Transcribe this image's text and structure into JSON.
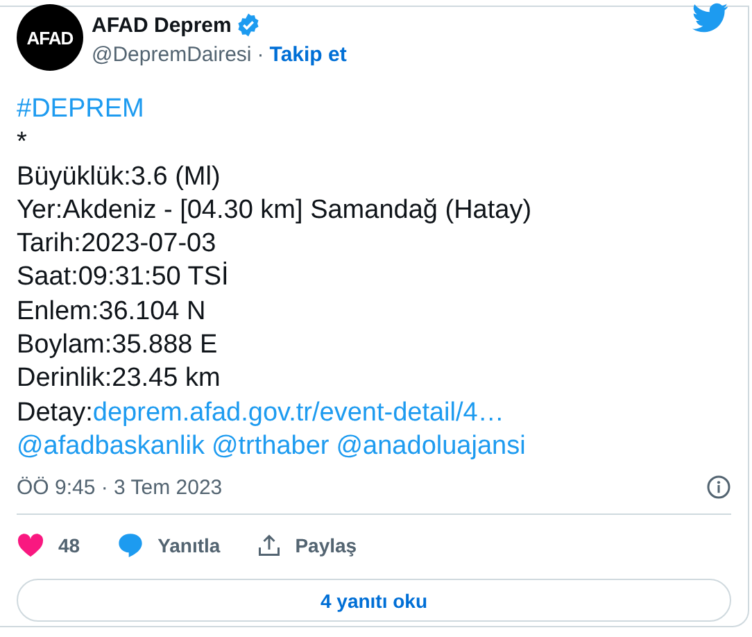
{
  "author": {
    "name": "AFAD Deprem",
    "avatar_text": "AFAD",
    "verified": true,
    "handle": "@DepremDairesi",
    "separator": "·",
    "follow": "Takip et"
  },
  "body": [
    [
      {
        "kind": "link",
        "text": "#DEPREM"
      }
    ],
    [
      {
        "kind": "plain",
        "text": "*"
      }
    ],
    [
      {
        "kind": "plain",
        "text": "Büyüklük:3.6 (Ml)"
      }
    ],
    [
      {
        "kind": "plain",
        "text": "Yer:Akdeniz - [04.30 km] Samandağ (Hatay)"
      }
    ],
    [
      {
        "kind": "plain",
        "text": "Tarih:2023-07-03"
      }
    ],
    [
      {
        "kind": "plain",
        "text": "Saat:09:31:50 TSİ"
      }
    ],
    [
      {
        "kind": "plain",
        "text": "Enlem:36.104 N"
      }
    ],
    [
      {
        "kind": "plain",
        "text": "Boylam:35.888 E"
      }
    ],
    [
      {
        "kind": "plain",
        "text": "Derinlik:23.45 km"
      }
    ],
    [
      {
        "kind": "plain",
        "text": "Detay:"
      },
      {
        "kind": "link",
        "text": "deprem.afad.gov.tr/event-detail/4…"
      }
    ],
    [
      {
        "kind": "link",
        "text": "@afadbaskanlik"
      },
      {
        "kind": "link",
        "text": "@trthaber"
      },
      {
        "kind": "link",
        "text": "@anadoluajansi"
      }
    ]
  ],
  "timestamp": "ÖÖ 9:45 · 3 Tem 2023",
  "actions": {
    "likes": "48",
    "liked": true,
    "reply": "Yanıtla",
    "share": "Paylaş"
  },
  "read_replies": "4 yanıtı oku"
}
